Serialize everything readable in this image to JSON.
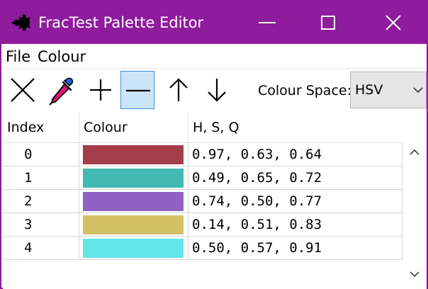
{
  "window": {
    "title": "FracTest Palette Editor",
    "icon": "mandelbrot-icon",
    "title_bar_color": "#8e1c9c",
    "controls": [
      "minimize-icon",
      "maximize-icon",
      "close-icon"
    ]
  },
  "menu": {
    "file": "File",
    "colour": "Colour"
  },
  "toolbar": {
    "tools": [
      "delete-icon",
      "eyedropper-icon",
      "plus-icon",
      "minus-icon",
      "arrow-up-icon",
      "arrow-down-icon"
    ],
    "active_tool": "minus-icon",
    "colour_space_label": "Colour Space:",
    "colour_space_value": "HSV"
  },
  "table": {
    "headers": {
      "index": "Index",
      "colour": "Colour",
      "values": "H, S, Q"
    },
    "rows": [
      {
        "index": "0",
        "swatch": "#a43c4a",
        "values": "0.97, 0.63, 0.64"
      },
      {
        "index": "1",
        "swatch": "#42b9b3",
        "values": "0.49, 0.65, 0.72"
      },
      {
        "index": "2",
        "swatch": "#8f61c4",
        "values": "0.74, 0.50, 0.77"
      },
      {
        "index": "3",
        "swatch": "#d4c066",
        "values": "0.14, 0.51, 0.83"
      },
      {
        "index": "4",
        "swatch": "#64e6e8",
        "values": "0.50, 0.57, 0.91"
      }
    ]
  }
}
